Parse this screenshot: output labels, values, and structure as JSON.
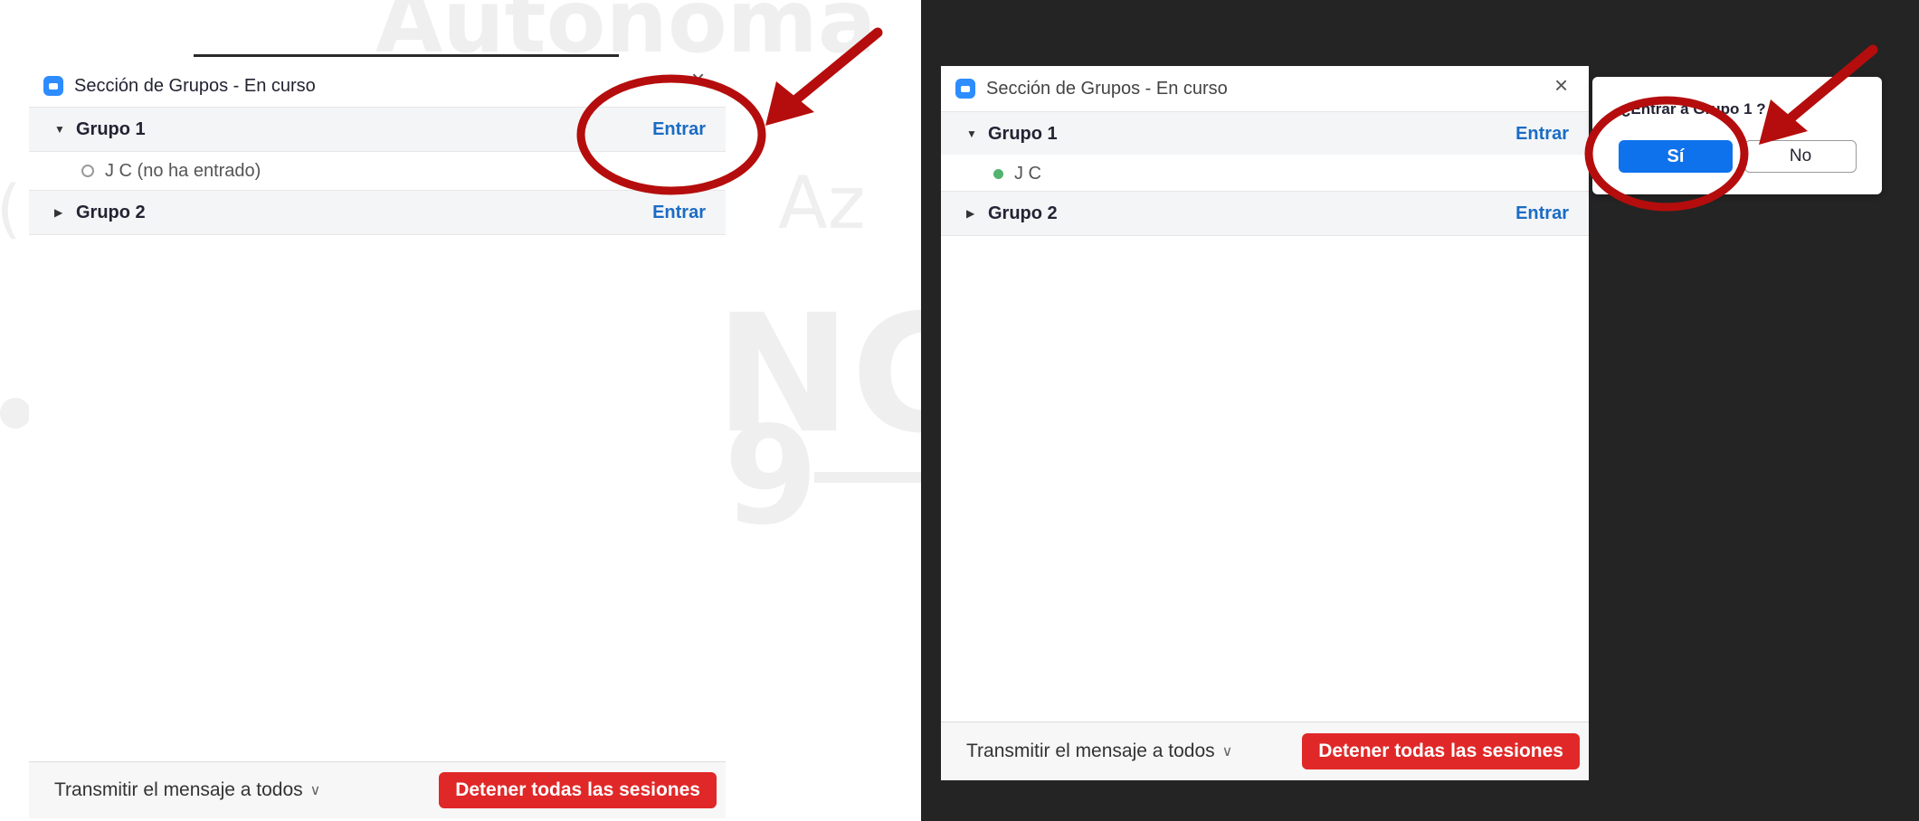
{
  "watermark": {
    "word": "Autonoma",
    "az": "Az",
    "ng": "NG",
    "nine": "9",
    "paren": "("
  },
  "left_panel": {
    "title": "Sección de Grupos - En curso",
    "close": "×",
    "groups": [
      {
        "name": "Grupo 1",
        "action": "Entrar",
        "caret": "▼",
        "members": [
          {
            "name": "J C (no ha entrado)",
            "status": "not-joined"
          }
        ]
      },
      {
        "name": "Grupo 2",
        "action": "Entrar",
        "caret": "▶"
      }
    ],
    "broadcast": "Transmitir el mensaje a todos",
    "stop_all": "Detener todas las sesiones"
  },
  "right_panel": {
    "title": "Sección de Grupos - En curso",
    "close": "×",
    "groups": [
      {
        "name": "Grupo 1",
        "action": "Entrar",
        "caret": "▼",
        "members": [
          {
            "name": "J C",
            "status": "joined"
          }
        ]
      },
      {
        "name": "Grupo 2",
        "action": "Entrar",
        "caret": "▶"
      }
    ],
    "broadcast": "Transmitir el mensaje a todos",
    "stop_all": "Detener todas las sesiones"
  },
  "dialog": {
    "question": "¿Entrar a Grupo 1 ?",
    "yes": "Sí",
    "no": "No"
  },
  "colors": {
    "accent": "#0e72ed",
    "link": "#1a6cc4",
    "danger": "#e02828",
    "annotation": "#b50d0d",
    "dark_bg": "#242424"
  }
}
